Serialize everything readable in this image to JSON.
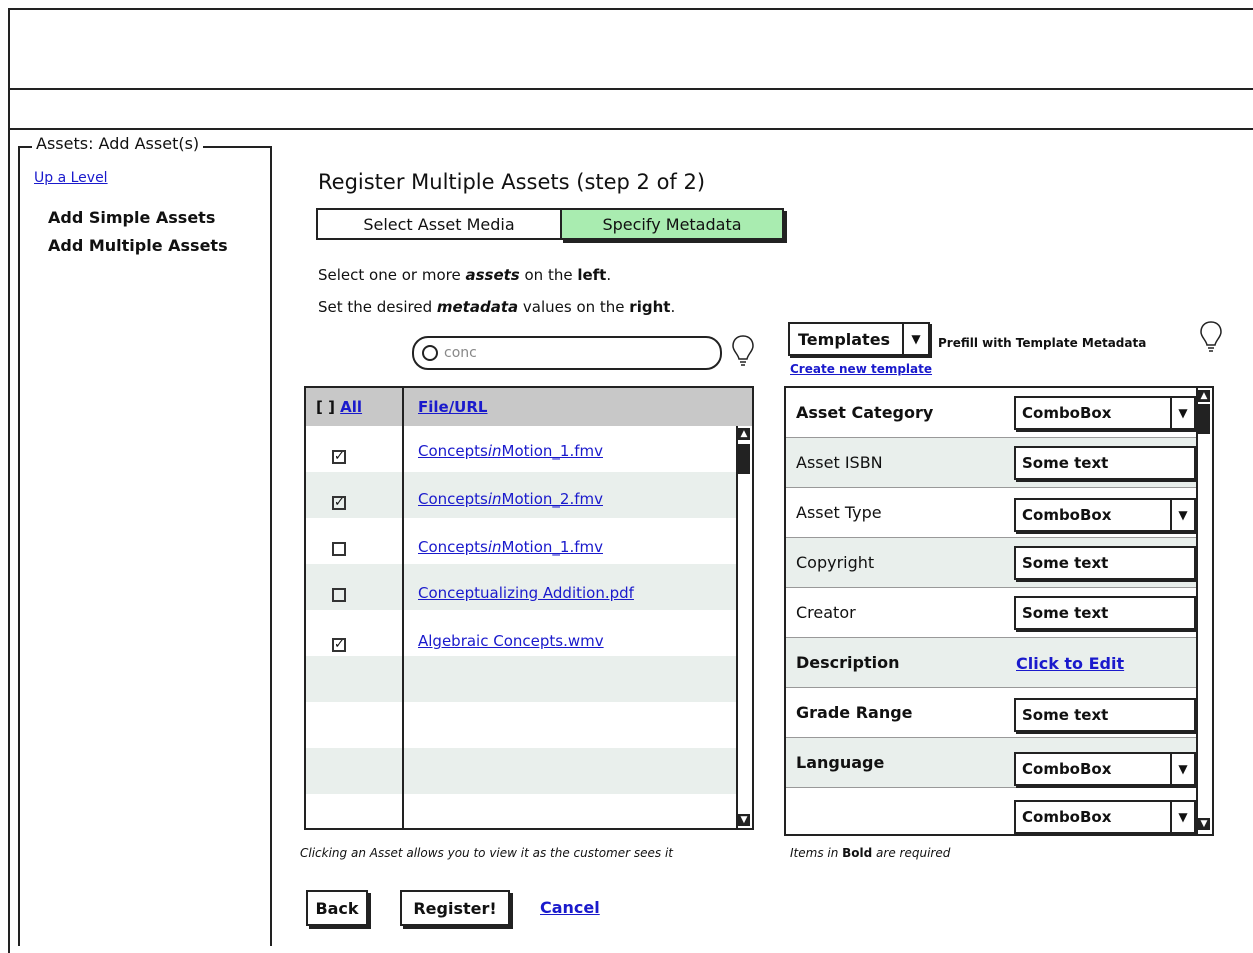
{
  "sidebar": {
    "title": "Assets: Add Asset(s)",
    "up_level": "Up a Level",
    "items": [
      {
        "label": "Add Simple Assets"
      },
      {
        "label": "Add Multiple Assets"
      }
    ]
  },
  "main": {
    "heading": "Register Multiple Assets (step 2 of 2)",
    "tabs": [
      {
        "label": "Select Asset Media",
        "active": false
      },
      {
        "label": "Specify Metadata",
        "active": true
      }
    ],
    "instructions": {
      "line1_pre": "Select one or more ",
      "line1_em": "assets",
      "line1_mid": " on the ",
      "line1_strong": "left",
      "line1_post": ".",
      "line2_pre": "Set the desired ",
      "line2_em": "metadata",
      "line2_mid": " values on the ",
      "line2_strong": "right",
      "line2_post": "."
    },
    "search": {
      "value": "conc"
    },
    "assets_table": {
      "col_select": "[ ]",
      "col_all": "All",
      "col_file": "File/URL",
      "rows": [
        {
          "checked": true,
          "file": "ConceptsinMotion_1.fmv",
          "file_pre": "Concepts",
          "file_em": "in",
          "file_post": "Motion_1.fmv"
        },
        {
          "checked": true,
          "file": "ConceptsinMotion_2.fmv",
          "file_pre": "Concepts",
          "file_em": "in",
          "file_post": "Motion_2.fmv"
        },
        {
          "checked": false,
          "file": "ConceptsinMotion_1.fmv",
          "file_pre": "Concepts",
          "file_em": "in",
          "file_post": "Motion_1.fmv"
        },
        {
          "checked": false,
          "file": "Conceptualizing Addition.pdf",
          "file_pre": "Conceptualizing Addition.pdf",
          "file_em": "",
          "file_post": ""
        },
        {
          "checked": true,
          "file": "Algebraic Concepts.wmv",
          "file_pre": "Algebraic Concepts.wmv",
          "file_em": "",
          "file_post": ""
        }
      ],
      "note": "Clicking an Asset allows you to view it as the customer sees it"
    },
    "templates": {
      "select_label": "Templates",
      "prefill_label": "Prefill with Template Metadata",
      "create_link": "Create new template"
    },
    "metadata": {
      "rows": [
        {
          "label": "Asset Category",
          "required": true,
          "kind": "combo",
          "value": "ComboBox"
        },
        {
          "label": "Asset ISBN",
          "required": false,
          "kind": "text",
          "value": "Some text"
        },
        {
          "label": "Asset Type",
          "required": false,
          "kind": "combo",
          "value": "ComboBox"
        },
        {
          "label": "Copyright",
          "required": false,
          "kind": "text",
          "value": "Some text"
        },
        {
          "label": "Creator",
          "required": false,
          "kind": "text",
          "value": "Some text"
        },
        {
          "label": "Description",
          "required": true,
          "kind": "link",
          "value": "Click to Edit"
        },
        {
          "label": "Grade Range",
          "required": true,
          "kind": "text",
          "value": "Some text"
        },
        {
          "label": "Language",
          "required": true,
          "kind": "combo",
          "value": "ComboBox"
        },
        {
          "label": "",
          "required": false,
          "kind": "combo",
          "value": "ComboBox"
        }
      ],
      "note_pre": "Items in ",
      "note_bold": "Bold",
      "note_post": " are required"
    },
    "buttons": {
      "back": "Back",
      "register": "Register!",
      "cancel": "Cancel"
    }
  },
  "colors": {
    "active_tab": "#a9ecb0",
    "table_header": "#c8c8c8",
    "row_alt": "#e9efec",
    "link": "#1a1acc"
  }
}
